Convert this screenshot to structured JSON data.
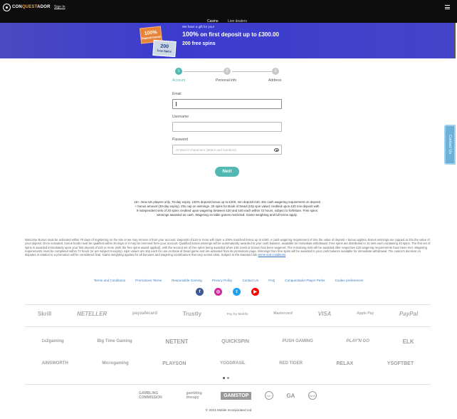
{
  "header": {
    "logo_prefix": "CON",
    "logo_accent": "QUEST",
    "logo_suffix": "ADOR",
    "sign_in": "Sign In"
  },
  "tabs": [
    {
      "label": "Casino",
      "active": true
    },
    {
      "label": "Live dealers",
      "active": false
    }
  ],
  "banner": {
    "gift_line": "We have a gift for you!",
    "badge_pct": "100%",
    "badge_pct_sub": "Deposit bonus",
    "badge_spins": "200",
    "badge_spins_sub": "Free Spins",
    "main_pct": "100%",
    "main_text": " on first deposit up to £300.00",
    "sub_text": "200 free spins"
  },
  "stepper": [
    {
      "number": "1",
      "label": "Account",
      "active": true
    },
    {
      "number": "2",
      "label": "Personal info",
      "active": false
    },
    {
      "number": "3",
      "label": "Address",
      "active": false
    }
  ],
  "form": {
    "email_label": "Email",
    "email_value": "",
    "username_label": "Username",
    "username_value": "",
    "password_label": "Password",
    "password_placeholder": "At least 8 characters (letters and numbers)",
    "next_label": "Next"
  },
  "offer_terms": "18+. New UK players only. 70-day expiry. 100% deposit bonus up to £200, min deposit £20. 30x cash wagering requirement on deposit + bonus amount (30-day expiry). 20x cap on winnings. 20 spins for Book of Dead (10p spin value) credited upon £20 min deposit with 9 independent sets of 20 spins credited upon wagering between £20 and £40 each within 72 hours, subject to forfeiture. Free spins winnings awarded as cash. Wagering on table games restricted. Game weighting and full terms apply.",
  "welcome_text": "Welcome Bonus must be activated within 70 days of registering on the site or we may remove it from your account. Deposits of £20 or more will claim a 100% matched bonus up to £300. A cash wagering requirement of 20x the value of deposit + bonus applies. Bonus winnings are capped at 20x the value of your deposit. Once activated, bonus funds must be qualified within 30-days or it may be removed from your account. Qualified bonus winnings will be automatically awarded to your cash balance, available for immediate withdrawal. Free spins are distributed in 10 sets each containing 20 spins. The first set of spins is awarded immediately upon your first deposit of £20 or more (with the free spins award applied), with the second set of free spins being awarded when £40 (cash or bonus) has been wagered. The remaining sets will be awarded after respective £20 wagering requirements have been met. Wagering requirements must be completed within 72 hours (or are subject to expiry). Spin values are 10p each for use on Book of Dead game and are activated from its promotions page. Winnings from free spins will be awarded to your cash balance available for immediate withdrawal. The casino's decision on disputes in relation to a promotion will be considered final. Game weighting applies for all bonuses and wagering contributions that vary across slots. Subject to the standard site ",
  "welcome_link": "terms and conditions",
  "welcome_end": ".",
  "footer_links": [
    "Terms and Conditions",
    "Promotions Terms",
    "Responsible Gaming",
    "Privacy Policy",
    "Contact Us",
    "FAQ",
    "Conquestador Player Perks",
    "Cookie preferences"
  ],
  "socials": [
    {
      "name": "facebook-icon",
      "glyph": "f",
      "color": "#3b5998"
    },
    {
      "name": "instagram-icon",
      "glyph": "◎",
      "color": "#d6249f"
    },
    {
      "name": "twitter-icon",
      "glyph": "t",
      "color": "#1da1f2"
    },
    {
      "name": "youtube-icon",
      "glyph": "▶",
      "color": "#ff0000"
    }
  ],
  "payments": [
    "Skrill",
    "NETELLER",
    "paysafecard",
    "Trustly",
    "Pay by Mobile",
    "Mastercard",
    "VISA",
    "Apple Pay",
    "PayPal"
  ],
  "providers_row1": [
    "1x2gaming",
    "Big Time Gaming",
    "NETENT",
    "QUICKSPIN",
    "PUSH GAMING",
    "PLAY'N GO",
    "ELK"
  ],
  "providers_row2": [
    "AINSWORTH",
    "Microgaming",
    "PLAYSON",
    "YGGDRASIL",
    "RED TIGER",
    "RELAX",
    "YSOFTBET"
  ],
  "regulators": [
    "GAMBLING COMMISSION",
    "gambling therapy",
    "GAMSTOP",
    "18+",
    "GA",
    "IBAS"
  ],
  "copyright": "© 2021 Mobile Incorporated Ltd",
  "contact_tab": "Contact Us"
}
